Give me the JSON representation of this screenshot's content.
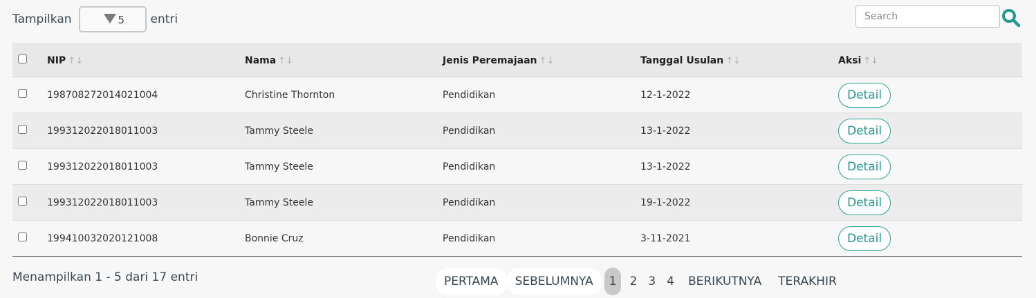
{
  "length_menu": {
    "prefix": "Tampilkan",
    "value": "5",
    "suffix": "entri"
  },
  "search": {
    "placeholder": "Search"
  },
  "table": {
    "headers": [
      "NIP",
      "Nama",
      "Jenis Peremajaan",
      "Tanggal Usulan",
      "Aksi"
    ],
    "sort_icon": "↑↓",
    "rows": [
      {
        "nip": "198708272014021004",
        "nama": "Christine Thornton",
        "jenis": "Pendidikan",
        "tanggal": "12-1-2022",
        "aksi": "Detail"
      },
      {
        "nip": "199312022018011003",
        "nama": "Tammy Steele",
        "jenis": "Pendidikan",
        "tanggal": "13-1-2022",
        "aksi": "Detail"
      },
      {
        "nip": "199312022018011003",
        "nama": "Tammy Steele",
        "jenis": "Pendidikan",
        "tanggal": "13-1-2022",
        "aksi": "Detail"
      },
      {
        "nip": "199312022018011003",
        "nama": "Tammy Steele",
        "jenis": "Pendidikan",
        "tanggal": "19-1-2022",
        "aksi": "Detail"
      },
      {
        "nip": "199410032020121008",
        "nama": "Bonnie Cruz",
        "jenis": "Pendidikan",
        "tanggal": "3-11-2021",
        "aksi": "Detail"
      }
    ]
  },
  "info": "Menampilkan 1 - 5 dari 17 entri",
  "pagination": {
    "first": "PERTAMA",
    "prev": "SEBELUMNYA",
    "pages": [
      "1",
      "2",
      "3",
      "4"
    ],
    "active_page": "1",
    "next": "BERIKUTNYA",
    "last": "TERAKHIR"
  },
  "colors": {
    "accent": "#23998f",
    "header_bg": "#e8e8e8",
    "stripe": "#ececec"
  },
  "icons": {
    "search": "search-icon",
    "dropdown": "caret-down-icon",
    "sort": "sort-icon"
  }
}
